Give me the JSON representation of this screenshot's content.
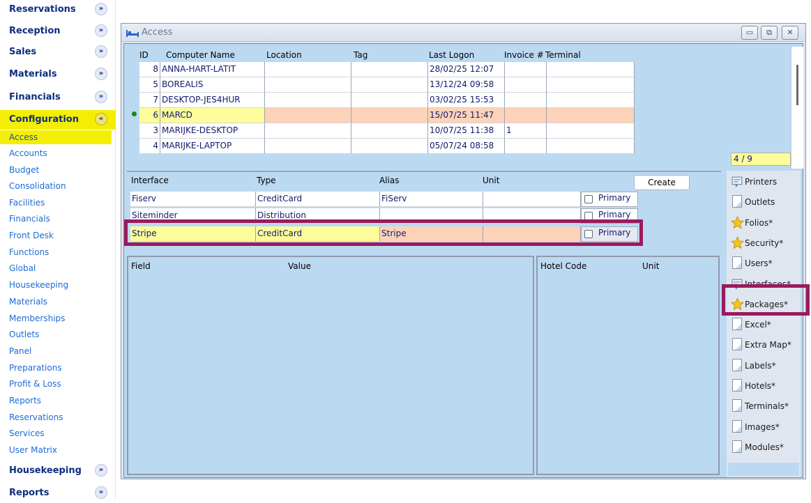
{
  "sidebar": {
    "sections_top": [
      {
        "label": "Reservations",
        "chevron": "»"
      },
      {
        "label": "Reception",
        "chevron": "»"
      },
      {
        "label": "Sales",
        "chevron": "»"
      },
      {
        "label": "Materials",
        "chevron": "»"
      },
      {
        "label": "Financials",
        "chevron": "»"
      },
      {
        "label": "Configuration",
        "chevron": "«"
      }
    ],
    "items": [
      "Access",
      "Accounts",
      "Budget",
      "Consolidation",
      "Facilities",
      "Financials",
      "Front Desk",
      "Functions",
      "Global",
      "Housekeeping",
      "Materials",
      "Memberships",
      "Outlets",
      "Panel",
      "Preparations",
      "Profit & Loss",
      "Reports",
      "Reservations",
      "Services",
      "User Matrix"
    ],
    "sections_bottom": [
      {
        "label": "Housekeeping",
        "chevron": "»"
      },
      {
        "label": "Reports",
        "chevron": "»"
      }
    ]
  },
  "window": {
    "title": "Access",
    "btn_min": "▭",
    "btn_max": "⧉",
    "btn_close": "✕"
  },
  "access_grid": {
    "headers": {
      "id": "ID",
      "computer": "Computer Name",
      "location": "Location",
      "tag": "Tag",
      "last_logon": "Last Logon",
      "invoice": "Invoice #",
      "terminal": "Terminal"
    },
    "rows": [
      {
        "id": "8",
        "computer": "ANNA-HART-LATIT",
        "location": "",
        "tag": "",
        "last_logon": "28/02/25 12:07",
        "invoice": "",
        "terminal": ""
      },
      {
        "id": "5",
        "computer": "BOREALIS",
        "location": "",
        "tag": "",
        "last_logon": "13/12/24 09:58",
        "invoice": "",
        "terminal": ""
      },
      {
        "id": "7",
        "computer": "DESKTOP-JES4HUR",
        "location": "",
        "tag": "",
        "last_logon": "03/02/25 15:53",
        "invoice": "",
        "terminal": ""
      },
      {
        "id": "6",
        "computer": "MARCD",
        "location": "",
        "tag": "",
        "last_logon": "15/07/25 11:47",
        "invoice": "",
        "terminal": ""
      },
      {
        "id": "3",
        "computer": "MARIJKE-DESKTOP",
        "location": "",
        "tag": "",
        "last_logon": "10/07/25 11:38",
        "invoice": "1",
        "terminal": ""
      },
      {
        "id": "4",
        "computer": "MARIJKE-LAPTOP",
        "location": "",
        "tag": "",
        "last_logon": "05/07/24 08:58",
        "invoice": "",
        "terminal": ""
      }
    ],
    "selected_index": 3,
    "counter": "4 / 9"
  },
  "interfaces": {
    "headers": {
      "interface": "Interface",
      "type": "Type",
      "alias": "Alias",
      "unit": "Unit"
    },
    "create_label": "Create",
    "rows": [
      {
        "interface": "Fiserv",
        "type": "CreditCard",
        "alias": "FiServ",
        "unit": "",
        "primary": "Primary"
      },
      {
        "interface": "Siteminder",
        "type": "Distribution",
        "alias": "",
        "unit": "",
        "primary": "Primary"
      },
      {
        "interface": "Stripe",
        "type": "CreditCard",
        "alias": "Stripe",
        "unit": "",
        "primary": "Primary"
      }
    ],
    "selected_index": 2
  },
  "field_pane": {
    "field": "Field",
    "value": "Value"
  },
  "hotel_pane": {
    "hotel_code": "Hotel Code",
    "unit": "Unit"
  },
  "right_panel": [
    {
      "label": "Printers",
      "icon": "printer-icon"
    },
    {
      "label": "Outlets",
      "icon": "document-icon"
    },
    {
      "label": "Folios*",
      "icon": "star-icon"
    },
    {
      "label": "Security*",
      "icon": "star-icon"
    },
    {
      "label": "Users*",
      "icon": "document-icon"
    },
    {
      "label": "Interfaces*",
      "icon": "interfaces-icon"
    },
    {
      "label": "Packages*",
      "icon": "star-icon"
    },
    {
      "label": "Excel*",
      "icon": "document-icon"
    },
    {
      "label": "Extra Map*",
      "icon": "document-icon"
    },
    {
      "label": "Labels*",
      "icon": "document-icon"
    },
    {
      "label": "Hotels*",
      "icon": "document-icon"
    },
    {
      "label": "Terminals*",
      "icon": "document-icon"
    },
    {
      "label": "Images*",
      "icon": "document-icon"
    },
    {
      "label": "Modules*",
      "icon": "document-icon"
    }
  ],
  "colors": {
    "highlight_box": "#9b1a5c",
    "selected_yellow": "#f4ee03",
    "row_peach": "#fcd3b8",
    "panel_blue": "#bcd9f2"
  }
}
